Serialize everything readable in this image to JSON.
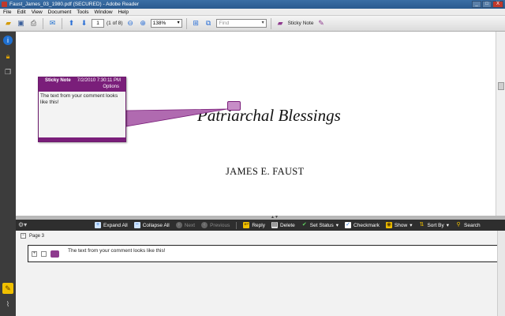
{
  "window": {
    "title": "Faust_James_03_1980.pdf (SECURED) - Adobe Reader",
    "buttons": {
      "minimize": "_",
      "maximize": "□",
      "close": "X"
    }
  },
  "menu": [
    "File",
    "Edit",
    "View",
    "Document",
    "Tools",
    "Window",
    "Help"
  ],
  "toolbar": {
    "page_value": "1",
    "page_count": "(1 of 8)",
    "zoom": "138%",
    "find_placeholder": "Find",
    "sticky_note_label": "Sticky Note"
  },
  "document": {
    "title": "Patriarchal Blessings",
    "author": "JAMES E. FAUST"
  },
  "note_popup": {
    "title": "Sticky Note",
    "date": "7/2/2010 7:30:11 PM",
    "options": "Options",
    "body": "The text from your comment looks like this!"
  },
  "comments_toolbar": {
    "expand_all": "Expand All",
    "collapse_all": "Collapse All",
    "next": "Next",
    "previous": "Previous",
    "reply": "Reply",
    "delete": "Delete",
    "set_status": "Set Status",
    "checkmark": "Checkmark",
    "show": "Show",
    "sort_by": "Sort By",
    "search": "Search"
  },
  "comments_list": {
    "page_label": "Page 3",
    "items": [
      {
        "text": "The text from your comment looks like this!"
      }
    ]
  },
  "colors": {
    "note_accent": "#7a1e7a",
    "titlebar": "#3a6ea5"
  },
  "icons": {
    "toolbar": [
      "open-icon",
      "save-icon",
      "print-icon",
      "email-icon",
      "prev-page-icon",
      "next-page-icon",
      "zoom-out-icon",
      "zoom-in-icon",
      "fit-page-icon",
      "full-screen-icon",
      "sticky-note-icon",
      "highlight-icon"
    ],
    "left_nav": [
      "info-icon",
      "lock-icon",
      "pages-icon",
      "comments-icon",
      "attachment-icon"
    ]
  }
}
